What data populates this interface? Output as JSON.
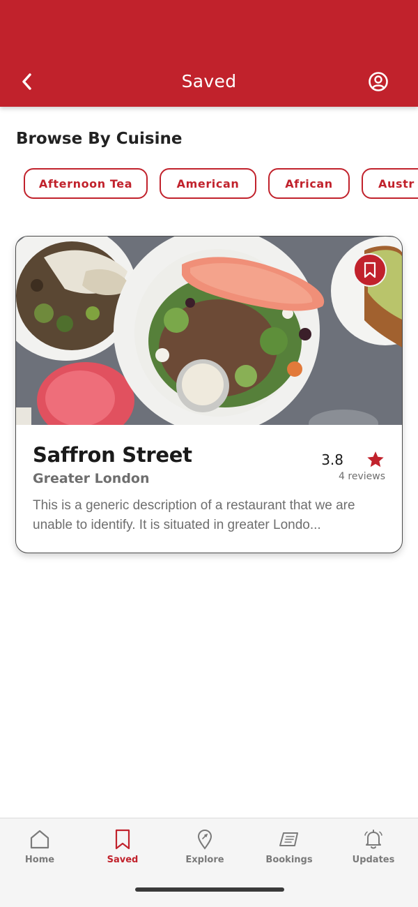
{
  "header": {
    "title": "Saved",
    "back_icon": "chevron-left-icon",
    "profile_icon": "user-circle-icon"
  },
  "browse": {
    "title": "Browse By Cuisine",
    "chips": [
      "Afternoon Tea",
      "American",
      "African",
      "Austr"
    ]
  },
  "restaurant": {
    "name": "Saffron Street",
    "location": "Greater London",
    "rating": "3.8",
    "reviews": "4 reviews",
    "description": "This is a generic description of a restaurant that we are unable to identify. It is situated in greater Londo...",
    "saved": true,
    "image_icon": "food-photo"
  },
  "nav": {
    "items": [
      {
        "label": "Home",
        "icon": "home-icon"
      },
      {
        "label": "Saved",
        "icon": "bookmark-icon"
      },
      {
        "label": "Explore",
        "icon": "explore-pin-icon"
      },
      {
        "label": "Bookings",
        "icon": "bookings-icon"
      },
      {
        "label": "Updates",
        "icon": "bell-icon"
      }
    ],
    "active": "Saved"
  },
  "colors": {
    "brand": "#c1222c",
    "muted_text": "#6e6e6e",
    "nav_background": "#f5f5f5"
  }
}
